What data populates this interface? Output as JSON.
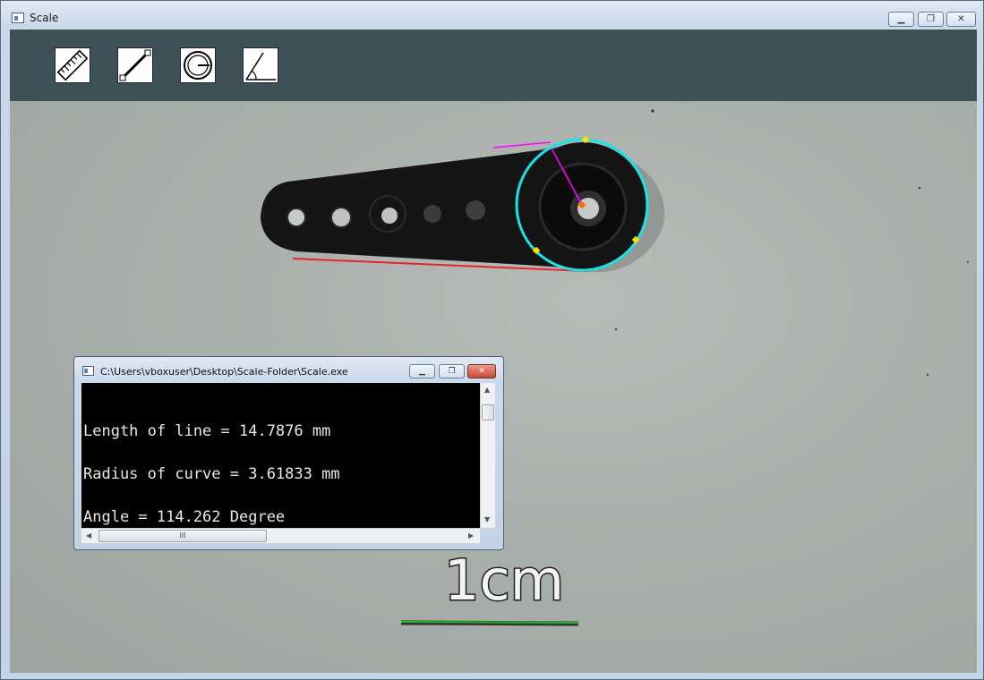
{
  "window": {
    "title": "Scale",
    "minimize_label": "▁",
    "maximize_label": "❐",
    "close_label": "✕"
  },
  "toolbar": {
    "tools": [
      {
        "name": "ruler-tool",
        "icon": "ruler-icon"
      },
      {
        "name": "line-tool",
        "icon": "line-icon"
      },
      {
        "name": "circle-tool",
        "icon": "circle-radius-icon"
      },
      {
        "name": "angle-tool",
        "icon": "angle-icon"
      }
    ]
  },
  "canvas": {
    "scale_label": "1cm",
    "overlay_colors": {
      "circle": "#19e4e8",
      "line": "#ff00ff",
      "bottom_edge": "#e8232a",
      "scale_bar": "#1fb81f",
      "points": "#ffe000",
      "center": "#ff6a00"
    }
  },
  "console": {
    "title": "C:\\Users\\vboxuser\\Desktop\\Scale-Folder\\Scale.exe",
    "lines": [
      "Length of line = 14.7876 mm",
      "Radius of curve = 3.61833 mm",
      "Angle = 114.262 Degree"
    ],
    "hscroll_grip": "III"
  }
}
